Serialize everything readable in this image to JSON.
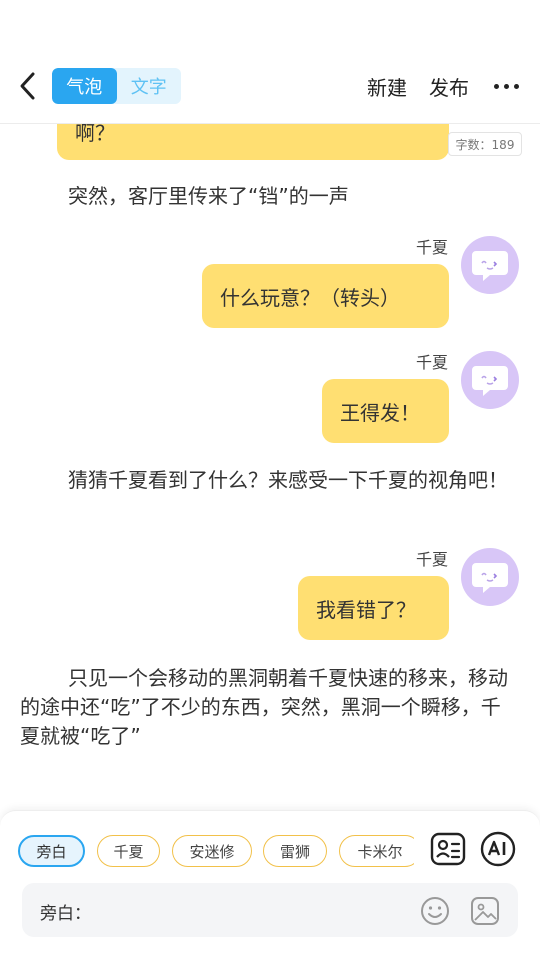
{
  "header": {
    "tabs": [
      {
        "label": "气泡",
        "active": true
      },
      {
        "label": "文字",
        "active": false
      }
    ],
    "new_label": "新建",
    "publish_label": "发布",
    "accent_color": "#2aa6f0"
  },
  "story": {
    "partial_bubble_text": "啊？",
    "word_count": "字数：189",
    "narration_1": "突然，客厅里传来了“铛”的一声",
    "messages": [
      {
        "speaker": "千夏",
        "text": "什么玩意？（转头）"
      },
      {
        "speaker": "千夏",
        "text": "王得发！"
      },
      {
        "speaker": "千夏",
        "text": "我看错了？"
      }
    ],
    "narration_2": "猜猜千夏看到了什么？来感受一下千夏的视角吧！",
    "narration_3": "只见一个会移动的黑洞朝着千夏快速的移来，移动的途中还“吃”了不少的东西，突然，黑洞一个瞬移，千夏就被“吃了”",
    "bubble_color": "#ffdf72"
  },
  "bottom": {
    "characters": [
      {
        "label": "旁白",
        "selected": true
      },
      {
        "label": "千夏",
        "selected": false
      },
      {
        "label": "安迷修",
        "selected": false
      },
      {
        "label": "雷狮",
        "selected": false
      },
      {
        "label": "卡米尔",
        "selected": false
      }
    ],
    "icons": [
      "character-card-icon",
      "ai-icon",
      "emoji-icon",
      "image-icon"
    ],
    "input_label": "旁白："
  }
}
